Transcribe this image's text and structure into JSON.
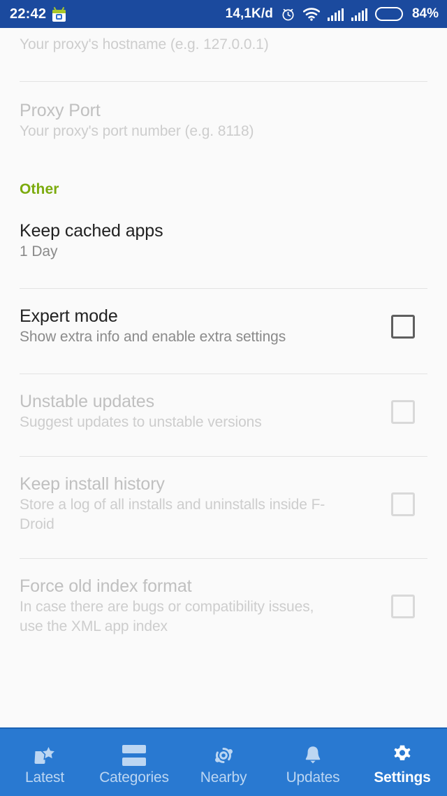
{
  "status_bar": {
    "clock": "22:42",
    "notification_icon": "fdroid-icon",
    "data_rate": "14,1K/d",
    "alarm_icon": "alarm-icon",
    "wifi_icon": "wifi-icon",
    "signal_icon_1": "signal-bars-icon",
    "signal_icon_2": "signal-bars-icon",
    "battery_icon": "battery-icon",
    "battery_percent": "84%",
    "background_color": "#1b4a9e",
    "battery_fill_color": "#ff9b1a"
  },
  "settings": {
    "accent_color": "#7cab0e",
    "preferences": [
      {
        "name": "proxy-host",
        "title": "",
        "summary": "Your proxy's hostname (e.g. 127.0.0.1)",
        "disabled": true,
        "has_checkbox": false,
        "checked": false
      },
      {
        "name": "proxy-port",
        "title": "Proxy Port",
        "summary": "Your proxy's port number (e.g. 8118)",
        "disabled": true,
        "has_checkbox": false,
        "checked": false
      }
    ],
    "other_section": {
      "header": "Other",
      "preferences": [
        {
          "name": "keep-cached-apps",
          "title": "Keep cached apps",
          "summary": "1 Day",
          "disabled": false,
          "has_checkbox": false,
          "checked": false
        },
        {
          "name": "expert-mode",
          "title": "Expert mode",
          "summary": "Show extra info and enable extra settings",
          "disabled": false,
          "has_checkbox": true,
          "checked": false
        },
        {
          "name": "unstable-updates",
          "title": "Unstable updates",
          "summary": "Suggest updates to unstable versions",
          "disabled": true,
          "has_checkbox": true,
          "checked": false
        },
        {
          "name": "keep-install-history",
          "title": "Keep install history",
          "summary": "Store a log of all installs and uninstalls inside F-Droid",
          "disabled": true,
          "has_checkbox": true,
          "checked": false
        },
        {
          "name": "force-old-index-format",
          "title": "Force old index format",
          "summary": "In case there are bugs or compatibility issues, use the XML app index",
          "disabled": true,
          "has_checkbox": true,
          "checked": false
        }
      ]
    }
  },
  "bottom_nav": {
    "background_color": "#2979d1",
    "active_index": 4,
    "items": [
      {
        "label": "Latest",
        "icon": "latest-star-icon",
        "active": false
      },
      {
        "label": "Categories",
        "icon": "categories-bars-icon",
        "active": false
      },
      {
        "label": "Nearby",
        "icon": "nearby-swap-icon",
        "active": false
      },
      {
        "label": "Updates",
        "icon": "bell-icon",
        "active": false
      },
      {
        "label": "Settings",
        "icon": "gear-icon",
        "active": true
      }
    ]
  }
}
